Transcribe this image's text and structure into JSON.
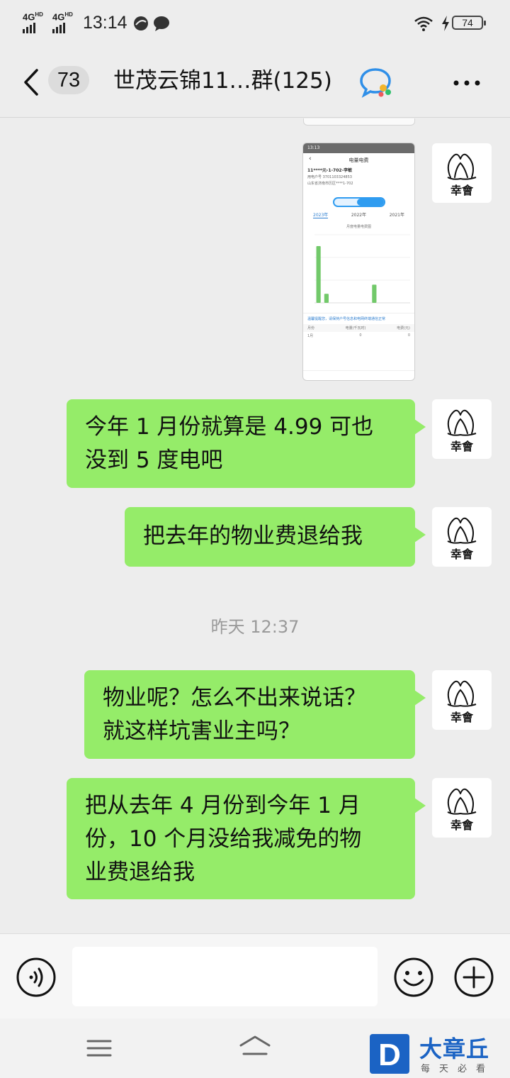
{
  "status_bar": {
    "network1": "4G",
    "network1_sup": "HD",
    "network2": "4G",
    "network2_sup": "HD",
    "time": "13:14",
    "battery": "74"
  },
  "header": {
    "unread_count": "73",
    "title": "世茂云锦11…群(125)"
  },
  "avatar_text": "幸會",
  "messages": [
    {
      "type": "image",
      "description_name": "electricity-bill-screenshot"
    },
    {
      "type": "text",
      "lines": [
        "今年 1 月份就算是 4.99 可也",
        "没到 5 度电吧"
      ]
    },
    {
      "type": "text",
      "lines": [
        "把去年的物业费退给我"
      ]
    },
    {
      "type": "timestamp",
      "text": "昨天 12:37"
    },
    {
      "type": "text",
      "lines": [
        "物业呢？怎么不出来说话？",
        "就这样坑害业主吗？"
      ]
    },
    {
      "type": "text",
      "lines": [
        "把从去年 4 月份到今年 1 月",
        "份，10 个月没给我减免的物",
        "业费退给我"
      ]
    }
  ],
  "screenshot": {
    "status_time": "13:13",
    "page_title": "电量电费",
    "account_line1": "11****元-1-702-李敏",
    "account_line2": "用电户号 3701103324853",
    "account_line3": "山东省济南市历区****1-702",
    "years": [
      "2023年",
      "2022年",
      "2021年"
    ],
    "chart_caption": "月度电量电费图",
    "link_text": "温馨提醒您，请保持户号信息和电网终端通信正常",
    "table_head": [
      "月份",
      "电量(千瓦时)",
      "电费(元)"
    ],
    "table_row": [
      "1月",
      "0",
      "0"
    ],
    "chart_data": {
      "type": "bar",
      "values": [
        5,
        0.8,
        0,
        0,
        0,
        0,
        0,
        1.6,
        0,
        0,
        0,
        0
      ],
      "ylim": [
        0,
        6
      ]
    }
  },
  "input": {
    "value": ""
  },
  "watermark": {
    "logo_letter": "D",
    "title": "大章丘",
    "subtitle": "每天必看"
  },
  "colors": {
    "bubble": "#95ec69",
    "background": "#ededed",
    "bar": "#72c96a"
  }
}
